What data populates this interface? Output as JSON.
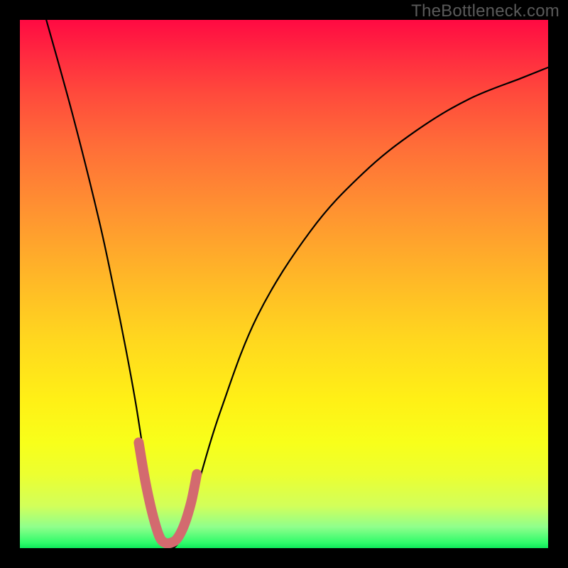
{
  "watermark": "TheBottleneck.com",
  "chart_data": {
    "type": "line",
    "title": "",
    "xlabel": "",
    "ylabel": "",
    "xlim": [
      0,
      100
    ],
    "ylim": [
      0,
      100
    ],
    "grid": false,
    "legend": false,
    "series": [
      {
        "name": "bottleneck-curve",
        "color": "#000000",
        "x": [
          5,
          10,
          15,
          18,
          20,
          22,
          24,
          25,
          26,
          27,
          28,
          29,
          30,
          31,
          32,
          34,
          38,
          45,
          55,
          65,
          75,
          85,
          95,
          100
        ],
        "values": [
          100,
          82,
          62,
          48,
          38,
          27,
          14,
          7,
          3,
          1,
          0,
          0,
          1,
          3,
          6,
          13,
          26,
          44,
          60,
          71,
          79,
          85,
          89,
          91
        ]
      },
      {
        "name": "valley-marker",
        "color": "#d36a6f",
        "x": [
          22.5,
          23.5,
          24.5,
          25.5,
          26.5,
          27.5,
          28.5,
          29.5,
          30.5,
          31.5,
          32.5,
          33.5
        ],
        "values": [
          20,
          14,
          9,
          5,
          2,
          1,
          1,
          1.5,
          3,
          5.5,
          9,
          14
        ]
      }
    ],
    "background_gradient_stops": [
      {
        "pos": 0,
        "color": "#ff0a42"
      },
      {
        "pos": 20,
        "color": "#ff5c3a"
      },
      {
        "pos": 50,
        "color": "#ffba26"
      },
      {
        "pos": 75,
        "color": "#fff016"
      },
      {
        "pos": 95,
        "color": "#a8ff70"
      },
      {
        "pos": 100,
        "color": "#0ee85a"
      }
    ]
  }
}
